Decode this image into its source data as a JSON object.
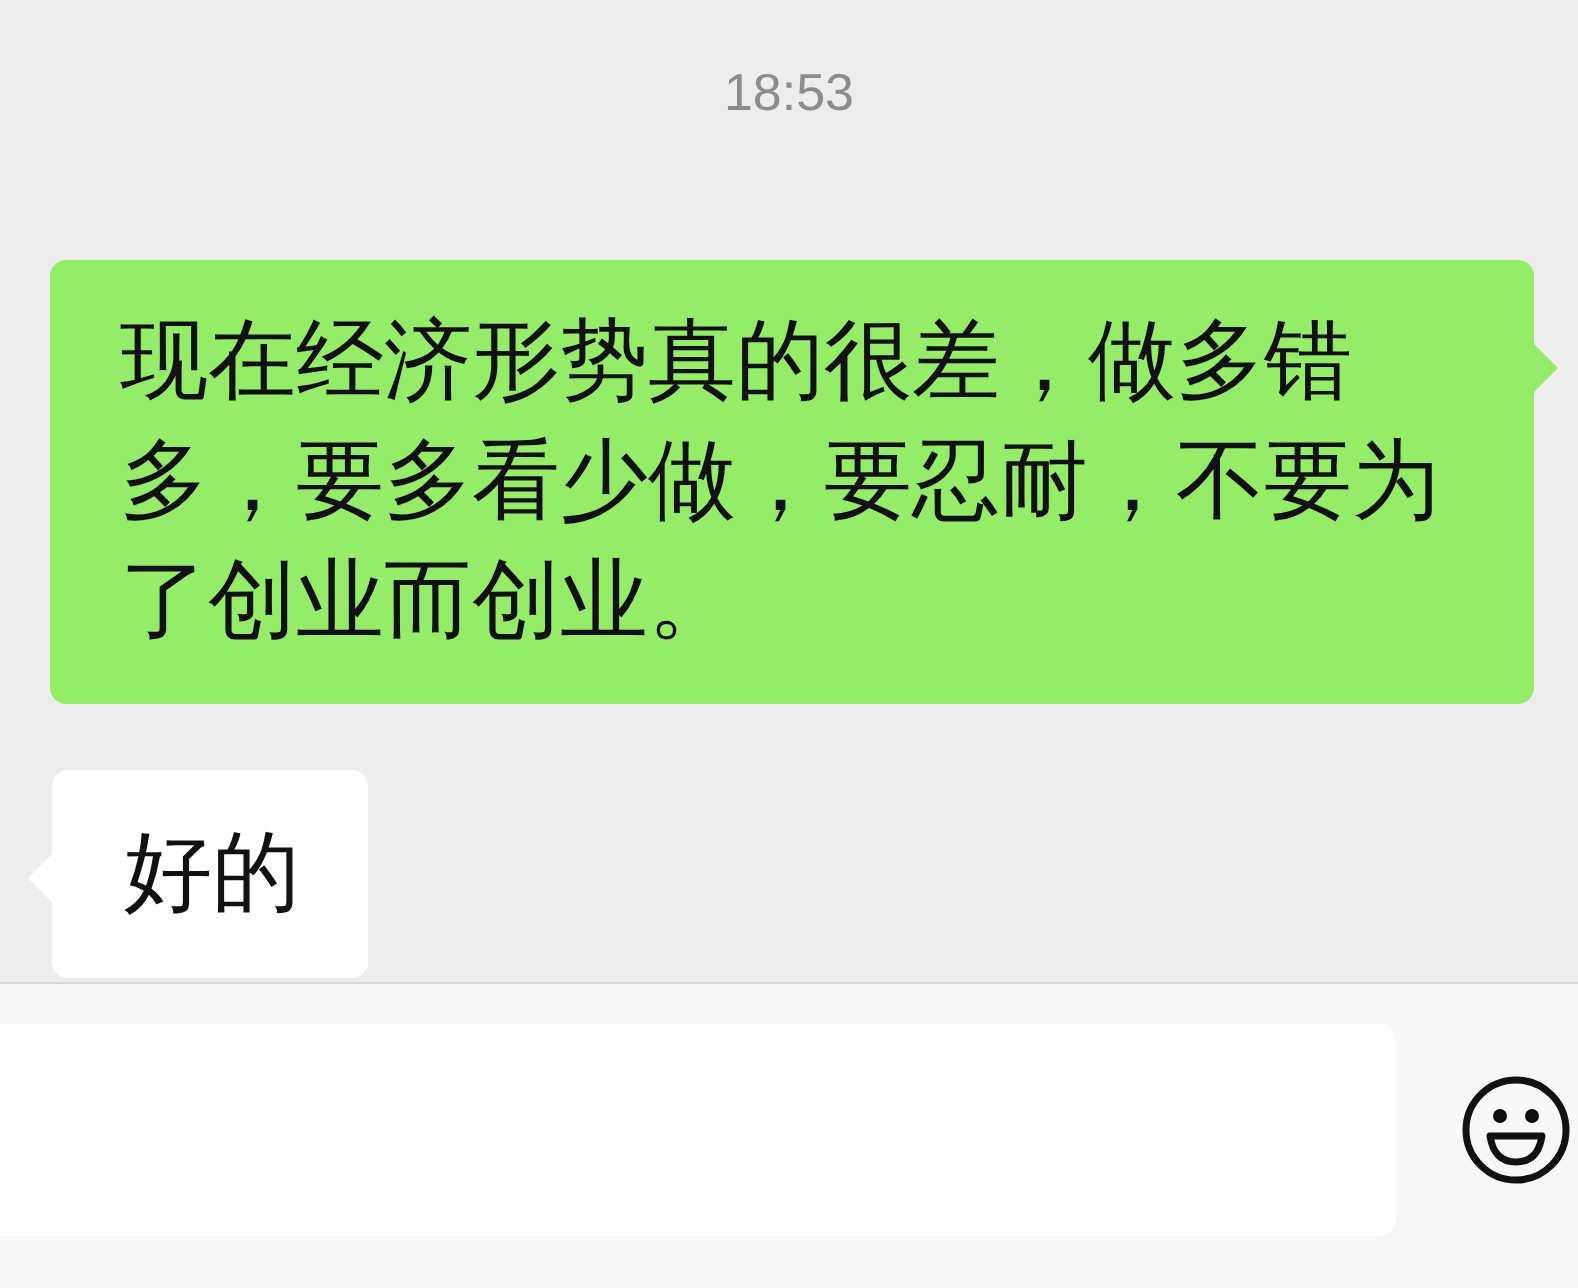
{
  "time": "18:53",
  "messages": [
    {
      "kind": "sent",
      "text": "现在经济形势真的很差，做多错多，要多看少做，要忍耐，不要为了创业而创业。"
    },
    {
      "kind": "received",
      "text": "好的"
    }
  ]
}
